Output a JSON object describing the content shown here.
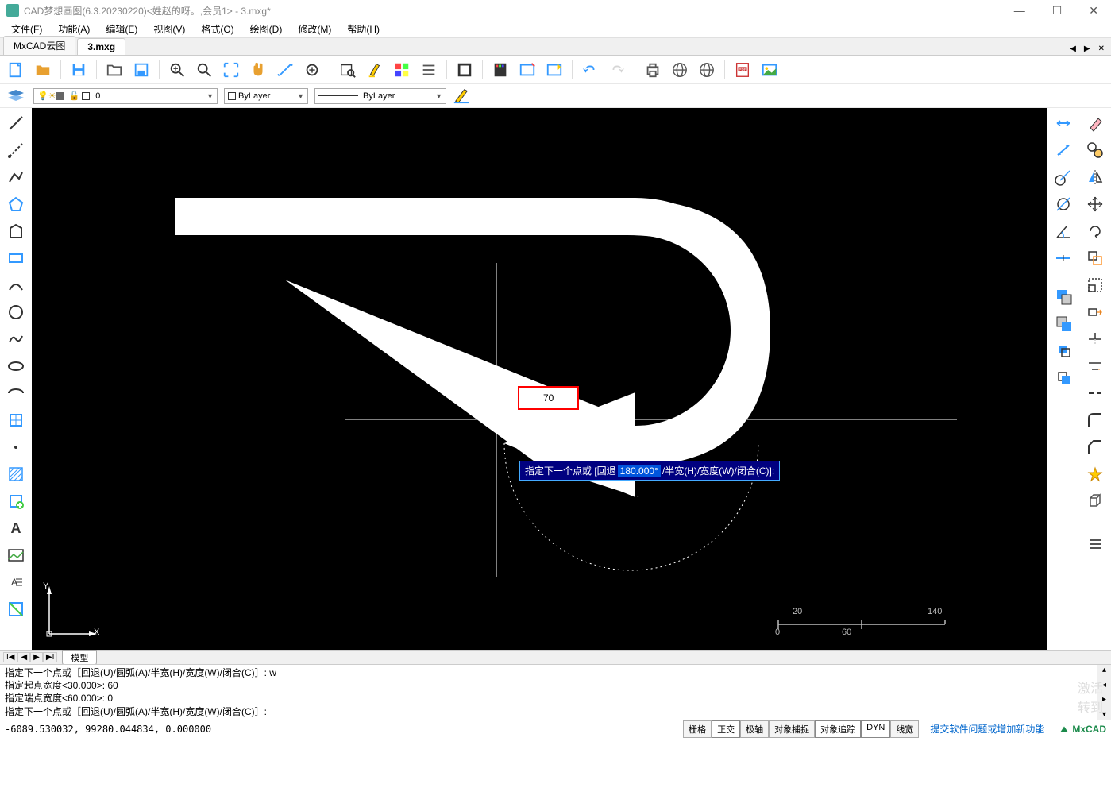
{
  "app": {
    "title": "CAD梦想画图(6.3.20230220)<姓赵的呀。,会员1> - 3.mxg*",
    "brand": "MxCAD"
  },
  "menu": [
    "文件(F)",
    "功能(A)",
    "编辑(E)",
    "视图(V)",
    "格式(O)",
    "绘图(D)",
    "修改(M)",
    "帮助(H)"
  ],
  "tabs": {
    "items": [
      "MxCAD云图",
      "3.mxg"
    ],
    "active": 1
  },
  "layer": {
    "current": "0",
    "color_combo": "ByLayer",
    "linetype_combo": "ByLayer"
  },
  "canvas": {
    "dyn_input": "70",
    "prompt_pre": "指定下一个点或 [回退",
    "prompt_angle": "180.000°",
    "prompt_post": "/半宽(H)/宽度(W)/闭合(C)]:",
    "ucs_y": "Y",
    "ucs_x": "X",
    "scale_ticks": [
      "20",
      "140",
      "0",
      "60"
    ]
  },
  "bottom_tab": "模型",
  "cmd_history": [
    "指定下一个点或［回退(U)/圆弧(A)/半宽(H)/宽度(W)/闭合(C)］: w",
    "指定起点宽度<30.000>: 60",
    "指定端点宽度<60.000>: 0",
    "指定下一个点或［回退(U)/圆弧(A)/半宽(H)/宽度(W)/闭合(C)］:"
  ],
  "status": {
    "coords": "-6089.530032, 99280.044834, 0.000000",
    "toggles": [
      "栅格",
      "正交",
      "极轴",
      "对象捕捉",
      "对象追踪",
      "DYN",
      "线宽"
    ],
    "active_toggles": [
      1,
      4,
      5
    ],
    "link": "提交软件问题或增加新功能"
  },
  "watermark": {
    "l1": "激活",
    "l2": "转到"
  }
}
